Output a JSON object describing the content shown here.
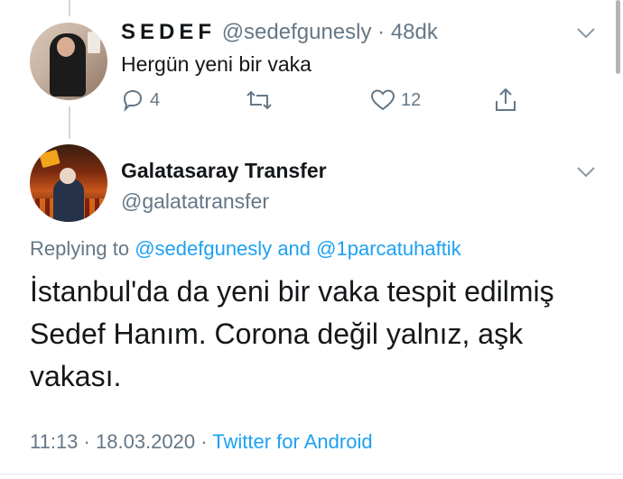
{
  "tweet1": {
    "display_name": "SEDEF",
    "handle": "@sedefgunesly",
    "separator": "·",
    "time": "48dk",
    "text": "Hergün yeni bir vaka",
    "replies": "4",
    "retweets": "",
    "likes": "12"
  },
  "tweet2": {
    "display_name": "Galatasaray Transfer",
    "handle": "@galatatransfer",
    "replying_to_label": "Replying to",
    "mention1": "@sedefgunesly",
    "and_label": "and",
    "mention2": "@1parcatuhaftik",
    "text": "İstanbul'da da yeni bir vaka tespit edilmiş Sedef Hanım. Corona değil yalnız, aşk vakası.",
    "time": "11:13",
    "dot": "·",
    "date": "18.03.2020",
    "source": "Twitter for Android"
  },
  "icons": {
    "reply": "reply-icon",
    "retweet": "retweet-icon",
    "like": "heart-icon",
    "share": "share-icon",
    "more": "chevron-down-icon"
  },
  "colors": {
    "accent": "#1da1f2",
    "muted": "#657786",
    "text": "#14171a"
  }
}
